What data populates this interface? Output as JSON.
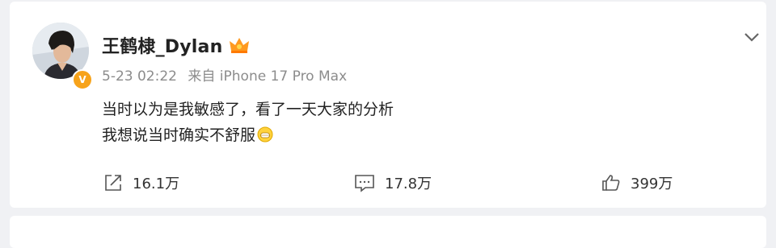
{
  "post": {
    "author_name": "王鹤棣_Dylan",
    "verified_badge_icon": "verified-v-icon",
    "member_icon": "crown-icon",
    "timestamp": "5-23 02:22",
    "source": "来自 iPhone 17 Pro Max",
    "content_lines": [
      "当时以为是我敏感了，看了一天大家的分析",
      "我想说当时确实不舒服"
    ],
    "content_emoji": "grin-emoji-icon",
    "more_icon": "chevron-down-icon"
  },
  "actions": {
    "repost_count": "16.1万",
    "comment_count": "17.8万",
    "like_count": "399万"
  },
  "colors": {
    "page_bg": "#f0f1f4",
    "card_bg": "#ffffff",
    "badge": "#f7a31a",
    "meta_text": "#8c8c8c"
  }
}
